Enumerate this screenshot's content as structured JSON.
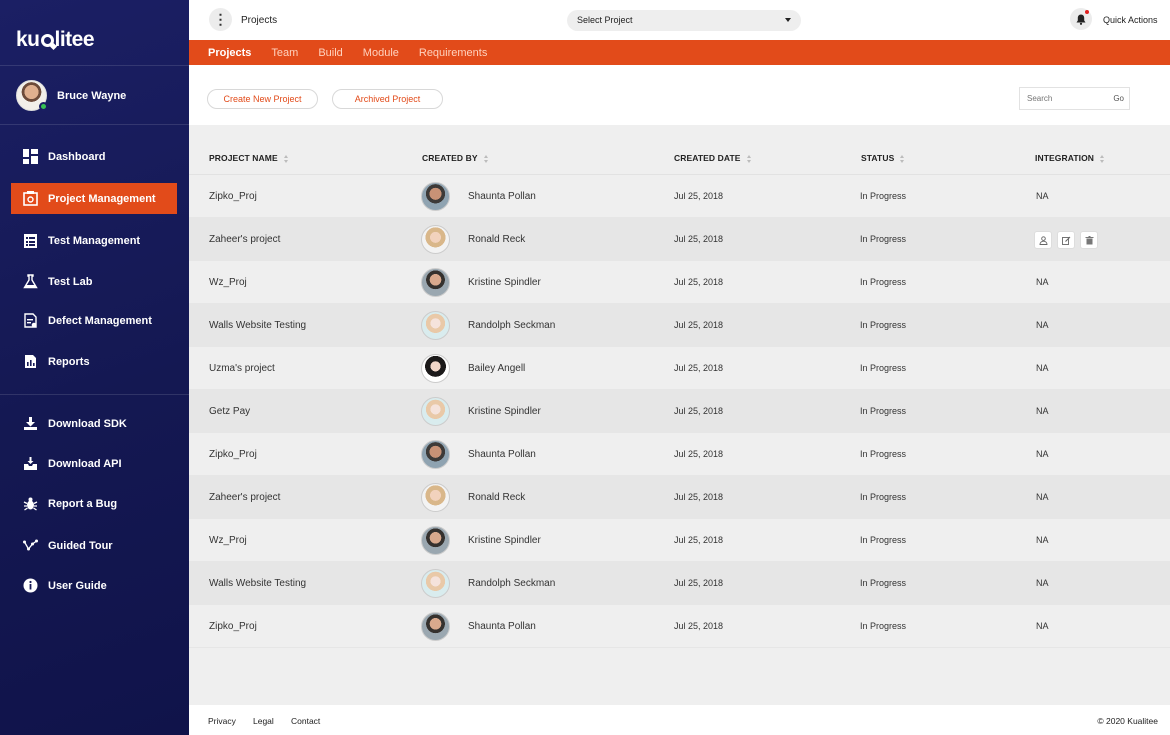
{
  "brand": {
    "logo_text": "kualitee"
  },
  "user": {
    "name": "Bruce Wayne"
  },
  "sidebar": {
    "main_items": [
      {
        "label": "Dashboard"
      },
      {
        "label": "Project Management"
      },
      {
        "label": "Test Management"
      },
      {
        "label": "Test Lab"
      },
      {
        "label": "Defect Management"
      },
      {
        "label": "Reports"
      }
    ],
    "secondary_items": [
      {
        "label": "Download SDK"
      },
      {
        "label": "Download API"
      },
      {
        "label": "Report a Bug"
      },
      {
        "label": "Guided Tour"
      },
      {
        "label": "User Guide"
      }
    ],
    "active_item": "Project Management"
  },
  "header": {
    "breadcrumb": "Projects",
    "select_project": "Select Project",
    "quick_actions": "Quick Actions"
  },
  "tabs": [
    {
      "label": "Projects",
      "active": true
    },
    {
      "label": "Team"
    },
    {
      "label": "Build"
    },
    {
      "label": "Module"
    },
    {
      "label": "Requirements"
    }
  ],
  "toolbar": {
    "create_label": "Create New Project",
    "archived_label": "Archived Project",
    "search_placeholder": "Search",
    "go_label": "Go"
  },
  "table": {
    "columns": [
      "PROJECT NAME",
      "CREATED BY",
      "CREATED DATE",
      "STATUS",
      "INTEGRATION"
    ],
    "rows": [
      {
        "name": "Zipko_Proj",
        "created_by": "Shaunta Pollan",
        "date": "Jul 25, 2018",
        "status": "In Progress",
        "integration": "NA"
      },
      {
        "name": "Zaheer's project",
        "created_by": "Ronald Reck",
        "date": "Jul 25, 2018",
        "status": "In Progress",
        "integration": ""
      },
      {
        "name": "Wz_Proj",
        "created_by": "Kristine Spindler",
        "date": "Jul 25, 2018",
        "status": "In Progress",
        "integration": "NA"
      },
      {
        "name": "Walls Website Testing",
        "created_by": "Randolph Seckman",
        "date": "Jul 25, 2018",
        "status": "In Progress",
        "integration": "NA"
      },
      {
        "name": "Uzma's project",
        "created_by": "Bailey Angell",
        "date": "Jul 25, 2018",
        "status": "In Progress",
        "integration": "NA"
      },
      {
        "name": "Getz Pay",
        "created_by": "Kristine Spindler",
        "date": "Jul 25, 2018",
        "status": "In Progress",
        "integration": "NA"
      },
      {
        "name": "Zipko_Proj",
        "created_by": "Shaunta Pollan",
        "date": "Jul 25, 2018",
        "status": "In Progress",
        "integration": "NA"
      },
      {
        "name": "Zaheer's project",
        "created_by": "Ronald Reck",
        "date": "Jul 25, 2018",
        "status": "In Progress",
        "integration": "NA"
      },
      {
        "name": "Wz_Proj",
        "created_by": "Kristine Spindler",
        "date": "Jul 25, 2018",
        "status": "In Progress",
        "integration": "NA"
      },
      {
        "name": "Walls Website Testing",
        "created_by": "Randolph Seckman",
        "date": "Jul 25, 2018",
        "status": "In Progress",
        "integration": "NA"
      },
      {
        "name": "Zipko_Proj",
        "created_by": "Shaunta Pollan",
        "date": "Jul 25, 2018",
        "status": "In Progress",
        "integration": "NA"
      }
    ]
  },
  "footer": {
    "links": [
      "Privacy",
      "Legal",
      "Contact"
    ],
    "copyright": "© 2020  Kualitee"
  },
  "colors": {
    "accent": "#e24b1a",
    "sidebar_bg": "#161a56",
    "online": "#37c253"
  }
}
